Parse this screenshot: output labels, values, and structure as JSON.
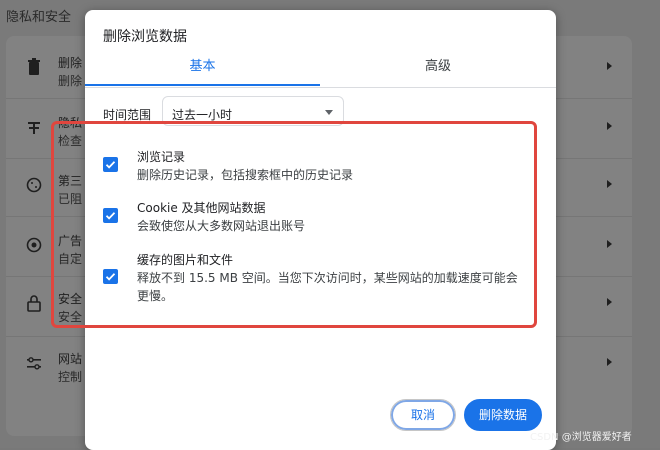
{
  "background": {
    "section_title": "隐私和安全",
    "rows": [
      {
        "title": "删除",
        "subtitle": "删除"
      },
      {
        "title": "隐私",
        "subtitle": "检查"
      },
      {
        "title": "第三",
        "subtitle": "已阻"
      },
      {
        "title": "广告",
        "subtitle": "自定"
      },
      {
        "title": "安全",
        "subtitle": "安全"
      },
      {
        "title": "网站",
        "subtitle": "控制"
      }
    ]
  },
  "dialog": {
    "title": "删除浏览数据",
    "tabs": [
      {
        "label": "基本",
        "active": true
      },
      {
        "label": "高级",
        "active": false
      }
    ],
    "time_range": {
      "label": "时间范围",
      "value": "过去一小时"
    },
    "options": [
      {
        "label": "浏览记录",
        "description": "删除历史记录，包括搜索框中的历史记录",
        "checked": true
      },
      {
        "label": "Cookie 及其他网站数据",
        "description": "会致使您从大多数网站退出账号",
        "checked": true
      },
      {
        "label": "缓存的图片和文件",
        "description": "释放不到 15.5 MB 空间。当您下次访问时，某些网站的加载速度可能会更慢。",
        "checked": true
      }
    ],
    "buttons": {
      "cancel": "取消",
      "delete": "删除数据"
    }
  },
  "colors": {
    "accent": "#1a73e8",
    "highlight": "#e0463e"
  },
  "watermark": "CSDN @浏览器爱好者"
}
